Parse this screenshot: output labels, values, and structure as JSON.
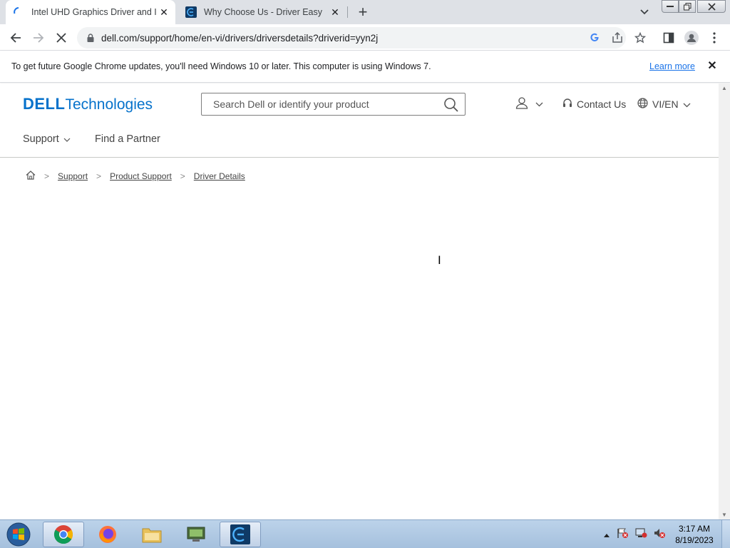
{
  "browser": {
    "tabs": [
      {
        "title": "Intel UHD Graphics Driver and In",
        "active": true
      },
      {
        "title": "Why Choose Us - Driver Easy",
        "active": false
      }
    ],
    "new_tab": "+",
    "url": "dell.com/support/home/en-vi/drivers/driversdetails?driverid=yyn2j"
  },
  "infobar": {
    "message": "To get future Google Chrome updates, you'll need Windows 10 or later. This computer is using Windows 7.",
    "learn_more": "Learn more"
  },
  "page": {
    "logo": {
      "dell": "DELL",
      "tech": "Technologies"
    },
    "search_placeholder": "Search Dell or identify your product",
    "contact": "Contact Us",
    "locale": "VI/EN",
    "nav": {
      "support": "Support",
      "partner": "Find a Partner"
    },
    "breadcrumb": [
      "Support",
      "Product Support",
      "Driver Details"
    ]
  },
  "taskbar": {
    "time": "3:17 AM",
    "date": "8/19/2023"
  },
  "colors": {
    "dell_blue": "#0672cb",
    "link_blue": "#1a73e8"
  }
}
